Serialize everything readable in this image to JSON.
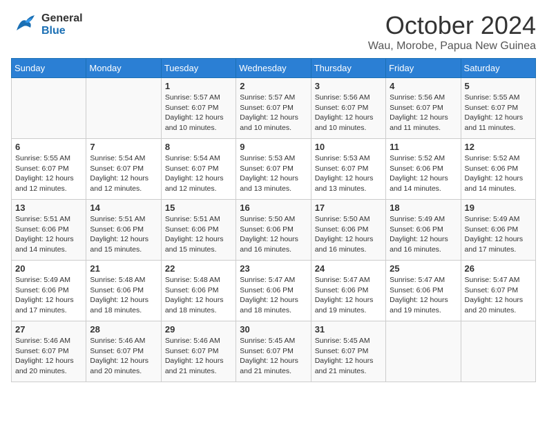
{
  "header": {
    "logo_general": "General",
    "logo_blue": "Blue",
    "month_title": "October 2024",
    "subtitle": "Wau, Morobe, Papua New Guinea"
  },
  "weekdays": [
    "Sunday",
    "Monday",
    "Tuesday",
    "Wednesday",
    "Thursday",
    "Friday",
    "Saturday"
  ],
  "weeks": [
    [
      {
        "day": "",
        "info": ""
      },
      {
        "day": "",
        "info": ""
      },
      {
        "day": "1",
        "info": "Sunrise: 5:57 AM\nSunset: 6:07 PM\nDaylight: 12 hours\nand 10 minutes."
      },
      {
        "day": "2",
        "info": "Sunrise: 5:57 AM\nSunset: 6:07 PM\nDaylight: 12 hours\nand 10 minutes."
      },
      {
        "day": "3",
        "info": "Sunrise: 5:56 AM\nSunset: 6:07 PM\nDaylight: 12 hours\nand 10 minutes."
      },
      {
        "day": "4",
        "info": "Sunrise: 5:56 AM\nSunset: 6:07 PM\nDaylight: 12 hours\nand 11 minutes."
      },
      {
        "day": "5",
        "info": "Sunrise: 5:55 AM\nSunset: 6:07 PM\nDaylight: 12 hours\nand 11 minutes."
      }
    ],
    [
      {
        "day": "6",
        "info": "Sunrise: 5:55 AM\nSunset: 6:07 PM\nDaylight: 12 hours\nand 12 minutes."
      },
      {
        "day": "7",
        "info": "Sunrise: 5:54 AM\nSunset: 6:07 PM\nDaylight: 12 hours\nand 12 minutes."
      },
      {
        "day": "8",
        "info": "Sunrise: 5:54 AM\nSunset: 6:07 PM\nDaylight: 12 hours\nand 12 minutes."
      },
      {
        "day": "9",
        "info": "Sunrise: 5:53 AM\nSunset: 6:07 PM\nDaylight: 12 hours\nand 13 minutes."
      },
      {
        "day": "10",
        "info": "Sunrise: 5:53 AM\nSunset: 6:07 PM\nDaylight: 12 hours\nand 13 minutes."
      },
      {
        "day": "11",
        "info": "Sunrise: 5:52 AM\nSunset: 6:06 PM\nDaylight: 12 hours\nand 14 minutes."
      },
      {
        "day": "12",
        "info": "Sunrise: 5:52 AM\nSunset: 6:06 PM\nDaylight: 12 hours\nand 14 minutes."
      }
    ],
    [
      {
        "day": "13",
        "info": "Sunrise: 5:51 AM\nSunset: 6:06 PM\nDaylight: 12 hours\nand 14 minutes."
      },
      {
        "day": "14",
        "info": "Sunrise: 5:51 AM\nSunset: 6:06 PM\nDaylight: 12 hours\nand 15 minutes."
      },
      {
        "day": "15",
        "info": "Sunrise: 5:51 AM\nSunset: 6:06 PM\nDaylight: 12 hours\nand 15 minutes."
      },
      {
        "day": "16",
        "info": "Sunrise: 5:50 AM\nSunset: 6:06 PM\nDaylight: 12 hours\nand 16 minutes."
      },
      {
        "day": "17",
        "info": "Sunrise: 5:50 AM\nSunset: 6:06 PM\nDaylight: 12 hours\nand 16 minutes."
      },
      {
        "day": "18",
        "info": "Sunrise: 5:49 AM\nSunset: 6:06 PM\nDaylight: 12 hours\nand 16 minutes."
      },
      {
        "day": "19",
        "info": "Sunrise: 5:49 AM\nSunset: 6:06 PM\nDaylight: 12 hours\nand 17 minutes."
      }
    ],
    [
      {
        "day": "20",
        "info": "Sunrise: 5:49 AM\nSunset: 6:06 PM\nDaylight: 12 hours\nand 17 minutes."
      },
      {
        "day": "21",
        "info": "Sunrise: 5:48 AM\nSunset: 6:06 PM\nDaylight: 12 hours\nand 18 minutes."
      },
      {
        "day": "22",
        "info": "Sunrise: 5:48 AM\nSunset: 6:06 PM\nDaylight: 12 hours\nand 18 minutes."
      },
      {
        "day": "23",
        "info": "Sunrise: 5:47 AM\nSunset: 6:06 PM\nDaylight: 12 hours\nand 18 minutes."
      },
      {
        "day": "24",
        "info": "Sunrise: 5:47 AM\nSunset: 6:06 PM\nDaylight: 12 hours\nand 19 minutes."
      },
      {
        "day": "25",
        "info": "Sunrise: 5:47 AM\nSunset: 6:06 PM\nDaylight: 12 hours\nand 19 minutes."
      },
      {
        "day": "26",
        "info": "Sunrise: 5:47 AM\nSunset: 6:07 PM\nDaylight: 12 hours\nand 20 minutes."
      }
    ],
    [
      {
        "day": "27",
        "info": "Sunrise: 5:46 AM\nSunset: 6:07 PM\nDaylight: 12 hours\nand 20 minutes."
      },
      {
        "day": "28",
        "info": "Sunrise: 5:46 AM\nSunset: 6:07 PM\nDaylight: 12 hours\nand 20 minutes."
      },
      {
        "day": "29",
        "info": "Sunrise: 5:46 AM\nSunset: 6:07 PM\nDaylight: 12 hours\nand 21 minutes."
      },
      {
        "day": "30",
        "info": "Sunrise: 5:45 AM\nSunset: 6:07 PM\nDaylight: 12 hours\nand 21 minutes."
      },
      {
        "day": "31",
        "info": "Sunrise: 5:45 AM\nSunset: 6:07 PM\nDaylight: 12 hours\nand 21 minutes."
      },
      {
        "day": "",
        "info": ""
      },
      {
        "day": "",
        "info": ""
      }
    ]
  ]
}
